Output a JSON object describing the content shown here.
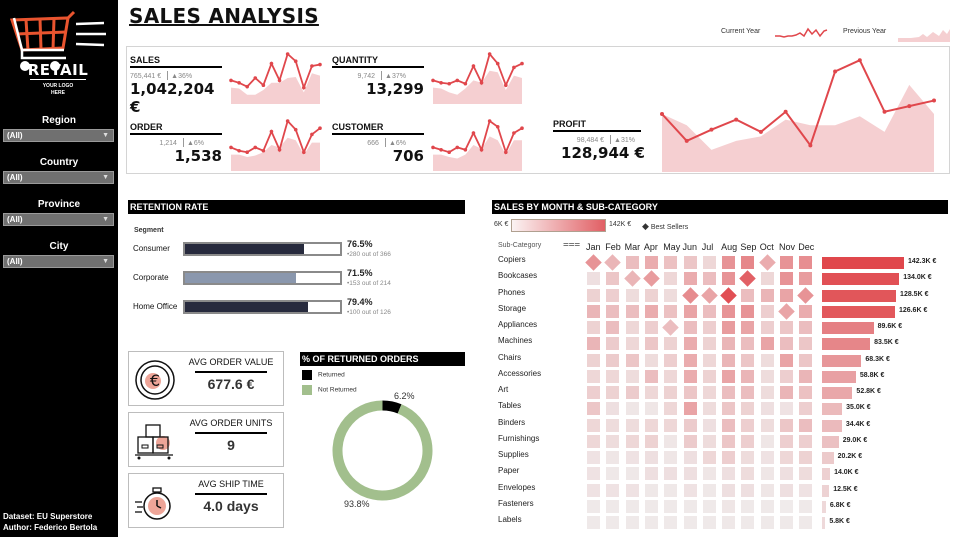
{
  "sidebar": {
    "logo": {
      "title": "RETAIL",
      "subtitle_line1": "YOUR LOGO",
      "subtitle_line2": "HERE"
    },
    "filters": [
      {
        "label": "Region",
        "value": "(All)"
      },
      {
        "label": "Country",
        "value": "(All)"
      },
      {
        "label": "Province",
        "value": "(All)"
      },
      {
        "label": "City",
        "value": "(All)"
      }
    ],
    "credits": {
      "dataset": "Dataset: EU Superstore",
      "author": "Author: Federico Bertola"
    }
  },
  "header": {
    "title": "SALES ANALYSIS"
  },
  "legend": {
    "current_year": "Current Year",
    "previous_year": "Previous Year"
  },
  "colors": {
    "accent": "#e0474c",
    "area": "#f5cfd1",
    "segment_dark": "#272a3d",
    "segment_light": "#8a97ad",
    "returned": "#000000",
    "not_returned": "#a2bf8d",
    "header_bg": "#000000"
  },
  "kpis": [
    {
      "name": "SALES",
      "previous": "765,441 €",
      "change": "36%",
      "value": "1,042,204 €",
      "current_series": [
        0.45,
        0.4,
        0.32,
        0.5,
        0.35,
        0.8,
        0.45,
        1.0,
        0.85,
        0.3,
        0.75,
        0.78
      ],
      "previous_series": [
        0.3,
        0.28,
        0.15,
        0.15,
        0.25,
        0.4,
        0.4,
        0.5,
        0.52,
        0.2,
        0.6,
        0.55
      ]
    },
    {
      "name": "QUANTITY",
      "previous": "9,742",
      "change": "37%",
      "value": "13,299",
      "current_series": [
        0.45,
        0.4,
        0.38,
        0.45,
        0.38,
        0.75,
        0.4,
        1.0,
        0.8,
        0.35,
        0.72,
        0.8
      ],
      "previous_series": [
        0.3,
        0.28,
        0.2,
        0.15,
        0.28,
        0.45,
        0.4,
        0.65,
        0.62,
        0.25,
        0.55,
        0.5
      ]
    },
    {
      "name": "ORDER",
      "previous": "1,214",
      "change": "6%",
      "value": "1,538",
      "current_series": [
        0.45,
        0.38,
        0.35,
        0.45,
        0.38,
        0.78,
        0.4,
        1.0,
        0.82,
        0.35,
        0.72,
        0.85
      ],
      "previous_series": [
        0.3,
        0.3,
        0.25,
        0.28,
        0.35,
        0.5,
        0.45,
        0.65,
        0.6,
        0.3,
        0.55,
        0.55
      ]
    },
    {
      "name": "CUSTOMER",
      "previous": "666",
      "change": "6%",
      "value": "706",
      "current_series": [
        0.45,
        0.4,
        0.35,
        0.45,
        0.4,
        0.75,
        0.4,
        1.0,
        0.88,
        0.35,
        0.75,
        0.85
      ],
      "previous_series": [
        0.3,
        0.3,
        0.25,
        0.22,
        0.3,
        0.5,
        0.42,
        0.68,
        0.6,
        0.3,
        0.6,
        0.6
      ]
    },
    {
      "name": "PROFIT",
      "previous": "98,484 €",
      "change": "31%",
      "value": "128,944 €",
      "current_series": [
        0.5,
        0.26,
        0.36,
        0.45,
        0.34,
        0.52,
        0.22,
        0.88,
        0.98,
        0.52,
        0.57,
        0.62
      ],
      "previous_series": [
        0.5,
        0.4,
        0.18,
        0.26,
        0.3,
        0.45,
        0.4,
        0.4,
        0.48,
        0.34,
        0.76,
        0.5
      ]
    }
  ],
  "retention": {
    "title": "RETENTION RATE",
    "segment_header": "Segment",
    "rows": [
      {
        "segment": "Consumer",
        "rate_pct": 76.5,
        "rate_label": "76.5%",
        "detail": "•280 out of 366",
        "color": "#272a3d"
      },
      {
        "segment": "Corporate",
        "rate_pct": 71.5,
        "rate_label": "71.5%",
        "detail": "•153 out of 214",
        "color": "#8a97ad"
      },
      {
        "segment": "Home Office",
        "rate_pct": 79.4,
        "rate_label": "79.4%",
        "detail": "•100 out of 126",
        "color": "#272a3d"
      }
    ]
  },
  "averages": [
    {
      "title": "AVG ORDER VALUE",
      "value": "677.6 €",
      "icon": "euro-coin-icon"
    },
    {
      "title": "AVG ORDER UNITS",
      "value": "9",
      "icon": "boxes-pallet-icon"
    },
    {
      "title": "AVG SHIP TIME",
      "value": "4.0 days",
      "icon": "stopwatch-icon"
    }
  ],
  "returns": {
    "title": "% OF RETURNED ORDERS",
    "legend": [
      {
        "label": "Returned",
        "color": "#000000"
      },
      {
        "label": "Not Returned",
        "color": "#a2bf8d"
      }
    ],
    "returned_pct": 6.2,
    "returned_label": "6.2%",
    "not_returned_pct": 93.8,
    "not_returned_label": "93.8%"
  },
  "chart_data": {
    "type": "heatmap",
    "title": "SALES BY MONTH & SUB-CATEGORY",
    "scale_min_label": "6K €",
    "scale_max_label": "142K €",
    "best_sellers_label": "Best Sellers",
    "row_header": "Sub-Category",
    "columns": [
      "Jan",
      "Feb",
      "Mar",
      "Apr",
      "May",
      "Jun",
      "Jul",
      "Aug",
      "Sep",
      "Oct",
      "Nov",
      "Dec"
    ],
    "rows": [
      {
        "name": "Copiers",
        "total": 142.3,
        "total_label": "142.3K €",
        "intensity": [
          0.55,
          0.35,
          0.3,
          0.4,
          0.28,
          0.25,
          0.15,
          0.55,
          0.62,
          0.4,
          0.55,
          0.58
        ],
        "best": [
          0,
          1,
          9
        ]
      },
      {
        "name": "Bookcases",
        "total": 134.0,
        "total_label": "134.0K €",
        "intensity": [
          0.1,
          0.25,
          0.35,
          0.5,
          0.15,
          0.4,
          0.3,
          0.55,
          0.85,
          0.15,
          0.55,
          0.5
        ],
        "best": [
          2,
          3,
          8
        ]
      },
      {
        "name": "Phones",
        "total": 128.5,
        "total_label": "128.5K €",
        "intensity": [
          0.18,
          0.2,
          0.12,
          0.18,
          0.12,
          0.6,
          0.45,
          0.95,
          0.3,
          0.35,
          0.45,
          0.55
        ],
        "best": [
          5,
          6,
          7,
          11
        ]
      },
      {
        "name": "Storage",
        "total": 126.6,
        "total_label": "126.6K €",
        "intensity": [
          0.35,
          0.3,
          0.3,
          0.4,
          0.28,
          0.45,
          0.3,
          0.55,
          0.55,
          0.2,
          0.45,
          0.4
        ],
        "best": [
          10
        ]
      },
      {
        "name": "Appliances",
        "total": 89.6,
        "total_label": "89.6K €",
        "intensity": [
          0.18,
          0.3,
          0.15,
          0.2,
          0.3,
          0.3,
          0.2,
          0.5,
          0.45,
          0.2,
          0.25,
          0.3
        ],
        "best": [
          4
        ]
      },
      {
        "name": "Machines",
        "total": 83.5,
        "total_label": "83.5K €",
        "intensity": [
          0.35,
          0.22,
          0.15,
          0.25,
          0.18,
          0.4,
          0.18,
          0.35,
          0.3,
          0.45,
          0.3,
          0.25
        ],
        "best": []
      },
      {
        "name": "Chairs",
        "total": 68.3,
        "total_label": "68.3K €",
        "intensity": [
          0.18,
          0.22,
          0.25,
          0.12,
          0.2,
          0.4,
          0.15,
          0.35,
          0.25,
          0.12,
          0.45,
          0.25
        ],
        "best": []
      },
      {
        "name": "Accessories",
        "total": 58.8,
        "total_label": "58.8K €",
        "intensity": [
          0.15,
          0.15,
          0.12,
          0.3,
          0.15,
          0.4,
          0.18,
          0.45,
          0.35,
          0.12,
          0.2,
          0.35
        ],
        "best": []
      },
      {
        "name": "Art",
        "total": 52.8,
        "total_label": "52.8K €",
        "intensity": [
          0.2,
          0.18,
          0.22,
          0.15,
          0.18,
          0.25,
          0.15,
          0.3,
          0.3,
          0.12,
          0.35,
          0.28
        ],
        "best": []
      },
      {
        "name": "Tables",
        "total": 35.0,
        "total_label": "35.0K €",
        "intensity": [
          0.25,
          0.1,
          0.06,
          0.06,
          0.15,
          0.45,
          0.12,
          0.25,
          0.18,
          0.1,
          0.08,
          0.2
        ],
        "best": []
      },
      {
        "name": "Binders",
        "total": 34.4,
        "total_label": "34.4K €",
        "intensity": [
          0.15,
          0.12,
          0.12,
          0.15,
          0.15,
          0.22,
          0.1,
          0.3,
          0.2,
          0.12,
          0.25,
          0.3
        ],
        "best": []
      },
      {
        "name": "Furnishings",
        "total": 29.0,
        "total_label": "29.0K €",
        "intensity": [
          0.15,
          0.12,
          0.15,
          0.18,
          0.06,
          0.22,
          0.12,
          0.25,
          0.2,
          0.06,
          0.2,
          0.2
        ],
        "best": []
      },
      {
        "name": "Supplies",
        "total": 20.2,
        "total_label": "20.2K €",
        "intensity": [
          0.08,
          0.06,
          0.08,
          0.1,
          0.06,
          0.1,
          0.15,
          0.2,
          0.12,
          0.08,
          0.15,
          0.18
        ],
        "best": []
      },
      {
        "name": "Paper",
        "total": 14.0,
        "total_label": "14.0K €",
        "intensity": [
          0.08,
          0.05,
          0.05,
          0.1,
          0.1,
          0.1,
          0.06,
          0.1,
          0.12,
          0.06,
          0.1,
          0.12
        ],
        "best": []
      },
      {
        "name": "Envelopes",
        "total": 12.5,
        "total_label": "12.5K €",
        "intensity": [
          0.08,
          0.08,
          0.08,
          0.05,
          0.05,
          0.08,
          0.05,
          0.1,
          0.1,
          0.06,
          0.1,
          0.08
        ],
        "best": []
      },
      {
        "name": "Fasteners",
        "total": 6.8,
        "total_label": "6.8K €",
        "intensity": [
          0.04,
          0.04,
          0.04,
          0.04,
          0.04,
          0.04,
          0.04,
          0.06,
          0.04,
          0.04,
          0.03,
          0.04
        ],
        "best": []
      },
      {
        "name": "Labels",
        "total": 5.8,
        "total_label": "5.8K €",
        "intensity": [
          0.04,
          0.04,
          0.04,
          0.04,
          0.04,
          0.04,
          0.04,
          0.05,
          0.04,
          0.04,
          0.04,
          0.04
        ],
        "best": []
      }
    ],
    "totals_max": 142.3
  }
}
